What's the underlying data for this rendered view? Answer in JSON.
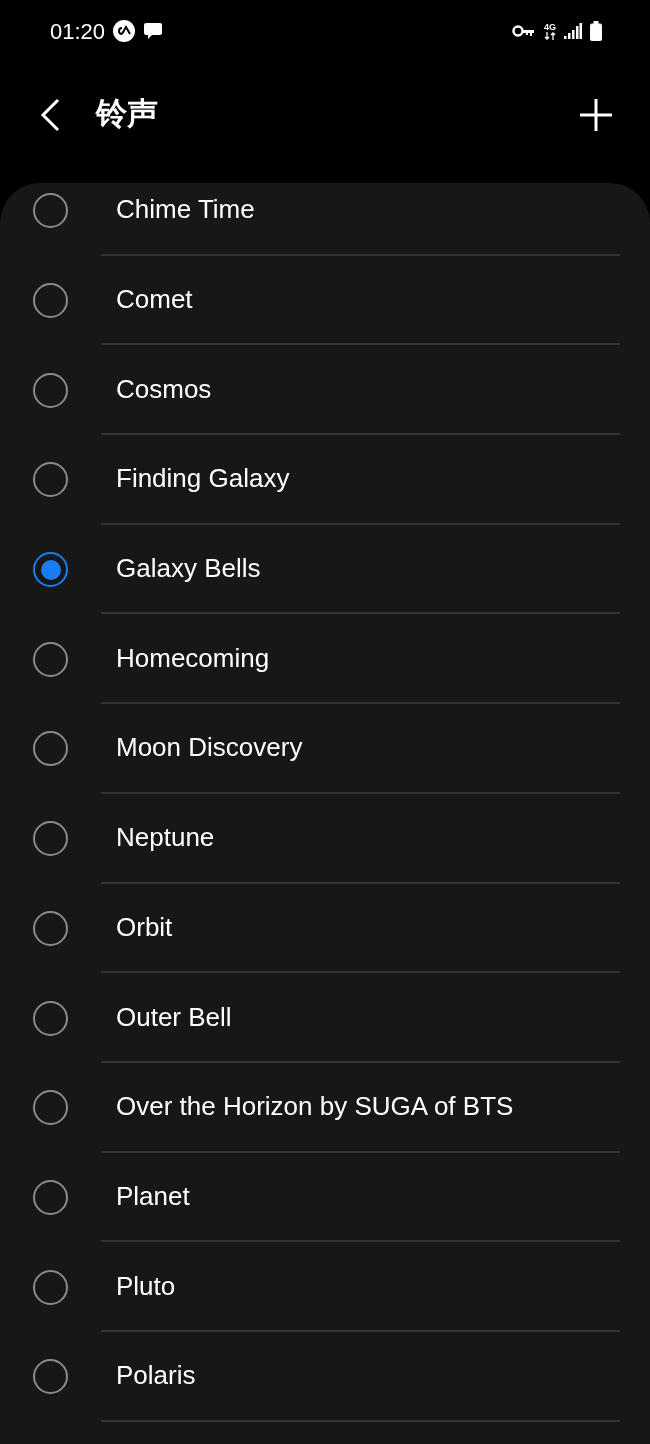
{
  "status_bar": {
    "time": "01:20",
    "network": "4G"
  },
  "header": {
    "title": "铃声"
  },
  "ringtones": [
    {
      "name": "Chime Time",
      "selected": false
    },
    {
      "name": "Comet",
      "selected": false
    },
    {
      "name": "Cosmos",
      "selected": false
    },
    {
      "name": "Finding Galaxy",
      "selected": false
    },
    {
      "name": "Galaxy Bells",
      "selected": true
    },
    {
      "name": "Homecoming",
      "selected": false
    },
    {
      "name": "Moon Discovery",
      "selected": false
    },
    {
      "name": "Neptune",
      "selected": false
    },
    {
      "name": "Orbit",
      "selected": false
    },
    {
      "name": "Outer Bell",
      "selected": false
    },
    {
      "name": "Over the Horizon by SUGA of BTS",
      "selected": false
    },
    {
      "name": "Planet",
      "selected": false
    },
    {
      "name": "Pluto",
      "selected": false
    },
    {
      "name": "Polaris",
      "selected": false
    }
  ]
}
